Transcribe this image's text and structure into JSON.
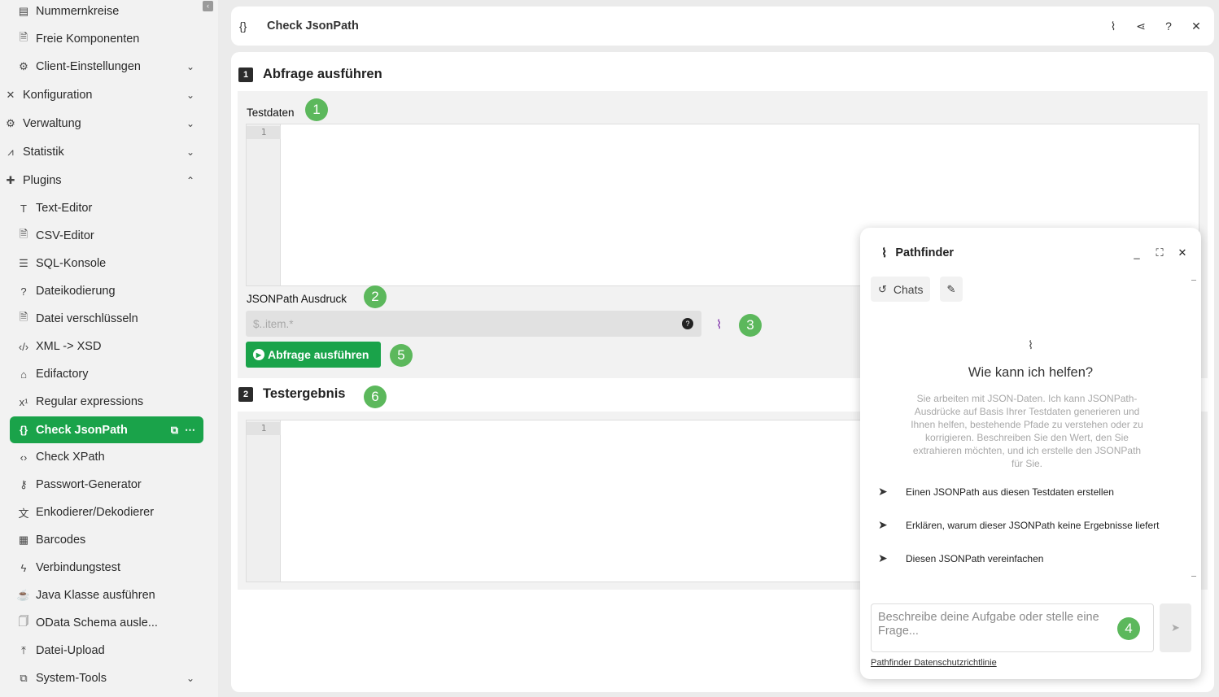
{
  "sidebar": {
    "collapse_icon": "chevron-left-icon",
    "items": [
      {
        "label": "Nummernkreise",
        "icon": "list-icon"
      },
      {
        "label": "Freie Komponenten",
        "icon": "document-icon"
      },
      {
        "label": "Client-Einstellungen",
        "icon": "gear-icon",
        "expandable": true
      },
      {
        "label": "Konfiguration",
        "icon": "tools-icon",
        "expandable": true
      },
      {
        "label": "Verwaltung",
        "icon": "gears-icon",
        "expandable": true
      },
      {
        "label": "Statistik",
        "icon": "chart-icon",
        "expandable": true
      },
      {
        "label": "Plugins",
        "icon": "puzzle-icon",
        "expandable": true,
        "expanded": true
      },
      {
        "label": "Text-Editor",
        "icon": "text-icon"
      },
      {
        "label": "CSV-Editor",
        "icon": "csv-icon"
      },
      {
        "label": "SQL-Konsole",
        "icon": "database-icon"
      },
      {
        "label": "Dateikodierung",
        "icon": "question-icon"
      },
      {
        "label": "Datei verschlüsseln",
        "icon": "lock-file-icon"
      },
      {
        "label": "XML -> XSD",
        "icon": "code-icon"
      },
      {
        "label": "Edifactory",
        "icon": "graduation-icon"
      },
      {
        "label": "Regular expressions",
        "icon": "superscript-icon"
      },
      {
        "label": "Check JsonPath",
        "icon": "json-path-icon",
        "active": true
      },
      {
        "label": "Check XPath",
        "icon": "xpath-icon"
      },
      {
        "label": "Passwort-Generator",
        "icon": "key-icon"
      },
      {
        "label": "Enkodierer/Dekodierer",
        "icon": "translate-icon"
      },
      {
        "label": "Barcodes",
        "icon": "qrcode-icon"
      },
      {
        "label": "Verbindungstest",
        "icon": "bolt-icon"
      },
      {
        "label": "Java Klasse ausführen",
        "icon": "java-icon"
      },
      {
        "label": "OData Schema ausle...",
        "icon": "files-icon"
      },
      {
        "label": "Datei-Upload",
        "icon": "upload-icon"
      },
      {
        "label": "System-Tools",
        "icon": "toolbox-icon",
        "expandable": true
      }
    ]
  },
  "header": {
    "title": "Check JsonPath",
    "buttons": [
      "sparkle-icon",
      "share-icon",
      "help-icon",
      "close-icon"
    ]
  },
  "section1": {
    "number": "1",
    "title": "Abfrage ausführen",
    "testdata_label": "Testdaten",
    "testdata_line": "1",
    "jsonpath_label": "JSONPath Ausdruck",
    "jsonpath_placeholder": "$..item.*",
    "run_button": "Abfrage ausführen"
  },
  "section2": {
    "number": "2",
    "title": "Testergebnis",
    "result_line": "1"
  },
  "markers": [
    "1",
    "2",
    "3",
    "4",
    "5",
    "6"
  ],
  "chat": {
    "title": "Pathfinder",
    "chats_button": "Chats",
    "welcome_title": "Wie kann ich helfen?",
    "welcome_text": "Sie arbeiten mit JSON-Daten. Ich kann JSONPath-Ausdrücke auf Basis Ihrer Testdaten generieren und Ihnen helfen, bestehende Pfade zu verstehen oder zu korrigieren. Beschreiben Sie den Wert, den Sie extrahieren möchten, und ich erstelle den JSONPath für Sie.",
    "suggestions": [
      "Einen JSONPath aus diesen Testdaten erstellen",
      "Erklären, warum dieser JSONPath keine Ergebnisse liefert",
      "Diesen JSONPath vereinfachen"
    ],
    "input_placeholder": "Beschreibe deine Aufgabe oder stelle eine Frage...",
    "privacy_link": "Pathfinder Datenschutzrichtlinie"
  },
  "colors": {
    "accent": "#1aa34a",
    "marker": "#5cb85c"
  }
}
